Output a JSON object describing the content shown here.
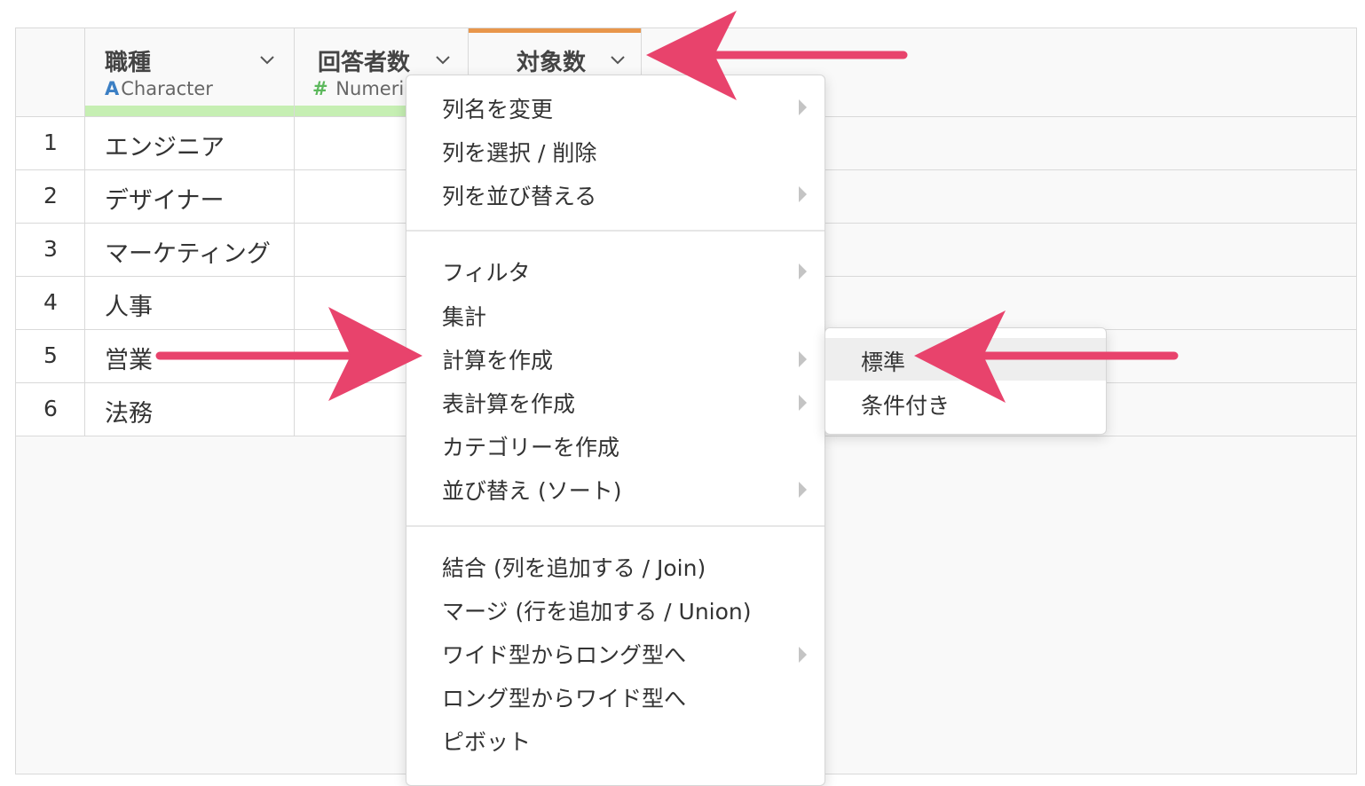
{
  "columns": [
    {
      "name": "職種",
      "type_symbol": "A",
      "type_label": "Character"
    },
    {
      "name": "回答者数",
      "type_symbol": "#",
      "type_label": "Numeri"
    },
    {
      "name": "対象数"
    }
  ],
  "rows": [
    {
      "num": "1",
      "value": "エンジニア"
    },
    {
      "num": "2",
      "value": "デザイナー"
    },
    {
      "num": "3",
      "value": "マーケティング"
    },
    {
      "num": "4",
      "value": "人事"
    },
    {
      "num": "5",
      "value": "営業"
    },
    {
      "num": "6",
      "value": "法務"
    }
  ],
  "menu": {
    "group1": [
      "列名を変更",
      "列を選択 / 削除",
      "列を並び替える"
    ],
    "group2": [
      "フィルタ",
      "集計",
      "計算を作成",
      "表計算を作成",
      "カテゴリーを作成",
      "並び替え (ソート)"
    ],
    "group3": [
      "結合 (列を追加する / Join)",
      "マージ (行を追加する / Union)",
      "ワイド型からロング型へ",
      "ロング型からワイド型へ",
      "ピボット"
    ]
  },
  "submenu": [
    "標準",
    "条件付き"
  ],
  "colors": {
    "annotation_arrow": "#e8436c",
    "active_column": "#e8964b",
    "character_type": "#3b7fc4",
    "numeric_type": "#5cb85c",
    "quality_bar": "#c6efb3"
  }
}
